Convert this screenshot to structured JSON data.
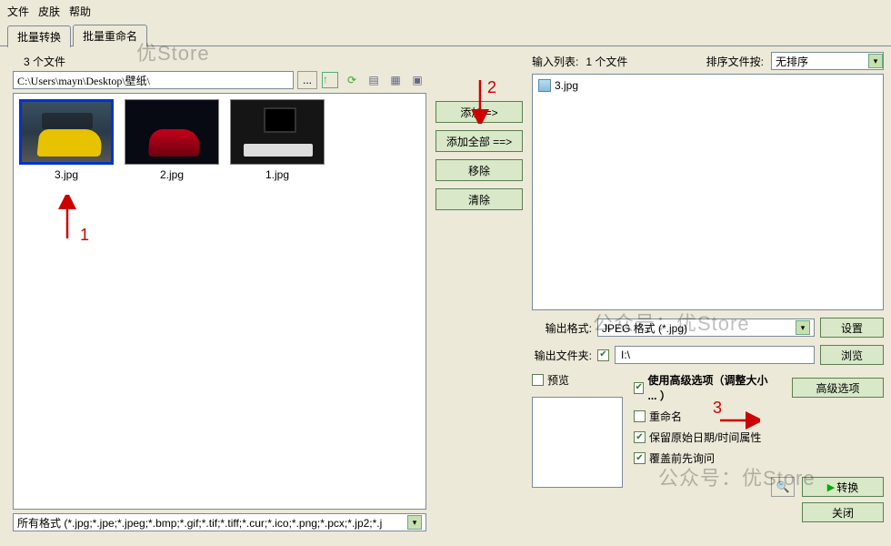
{
  "watermarks": {
    "w1": "优Store",
    "w2": "公众号：优Store",
    "w3": "公众号：优Store",
    "w4": "公众号：优Store"
  },
  "menu": {
    "file": "文件",
    "skin": "皮肤",
    "help": "帮助"
  },
  "tabs": {
    "batch_convert": "批量转换",
    "batch_rename": "批量重命名"
  },
  "file_count": "3 个文件",
  "path": "C:\\Users\\mayn\\Desktop\\壁纸\\",
  "browse_btn": "...",
  "thumbs": [
    {
      "name": "3.jpg"
    },
    {
      "name": "2.jpg"
    },
    {
      "name": "1.jpg"
    }
  ],
  "format_filter": "所有格式 (*.jpg;*.jpe;*.jpeg;*.bmp;*.gif;*.tif;*.tiff;*.cur;*.ico;*.png;*.pcx;*.jp2;*.j",
  "actions": {
    "add": "添加 =>",
    "add_all": "添加全部 ==>",
    "remove": "移除",
    "clear": "清除"
  },
  "right": {
    "input_list_label": "输入列表:",
    "input_count": "1 个文件",
    "sort_label": "排序文件按:",
    "sort_value": "无排序",
    "items": [
      "3.jpg"
    ]
  },
  "output": {
    "format_label": "输出格式:",
    "format_value": "JPEG 格式 (*.jpg)",
    "settings_btn": "设置",
    "folder_label": "输出文件夹:",
    "folder_value": "I:\\",
    "browse_btn": "浏览"
  },
  "preview": {
    "checkbox_label": "预览"
  },
  "options": {
    "use_adv": "使用高级选项（调整大小 ... ）",
    "adv_btn": "高级选项",
    "rename": "重命名",
    "keep_date": "保留原始日期/时间属性",
    "ask_overwrite": "覆盖前先询问"
  },
  "footer": {
    "convert": "转换",
    "close": "关闭"
  },
  "anno": {
    "n1": "1",
    "n2": "2",
    "n3": "3"
  }
}
